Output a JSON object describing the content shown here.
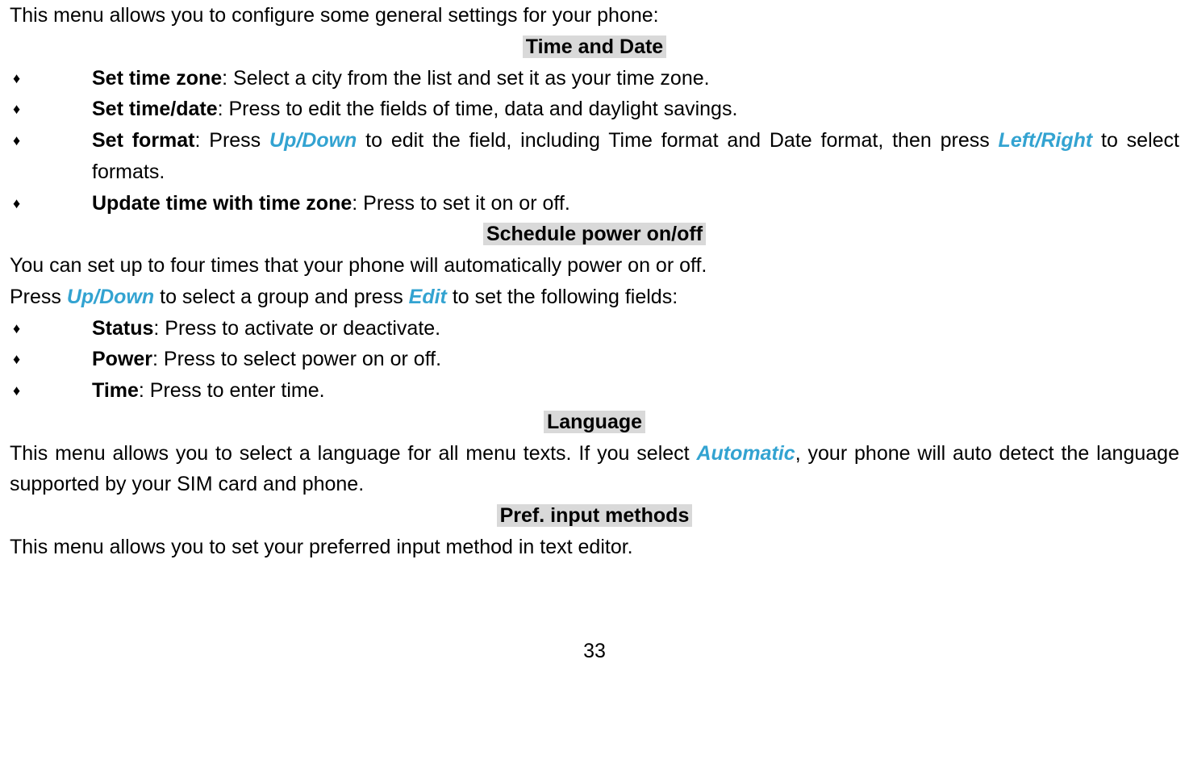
{
  "intro": "This menu allows you to configure some general settings for your phone:",
  "sections": {
    "time_date": {
      "heading": "Time and Date",
      "items": [
        {
          "label": "Set time zone",
          "text_after": ": Select a city from the list and set it as your time zone."
        },
        {
          "label": "Set time/date",
          "text_after": ": Press to edit the fields of time, data and daylight savings."
        },
        {
          "label": "Set format",
          "frag1": ": Press ",
          "key1": "Up/Down",
          "frag2": " to edit the field, including Time format and Date format, then press ",
          "key2": "Left/Right",
          "frag3": " to select formats."
        },
        {
          "label": "Update time with time zone",
          "text_after": ": Press to set it on or off."
        }
      ]
    },
    "schedule": {
      "heading": "Schedule power on/off",
      "para1": "You can set up to four times that your phone will automatically power on or off.",
      "para2_frag1": "Press ",
      "para2_key1": "Up/Down",
      "para2_frag2": " to select a group and press ",
      "para2_key2": "Edit",
      "para2_frag3": " to set the following fields:",
      "items": [
        {
          "label": "Status",
          "text_after": ": Press to activate or deactivate."
        },
        {
          "label": "Power",
          "text_after": ": Press to select power on or off."
        },
        {
          "label": "Time",
          "text_after": ": Press to enter time."
        }
      ]
    },
    "language": {
      "heading": "Language",
      "frag1": "This menu allows you to select a language for all menu texts. If you select ",
      "key1": "Automatic",
      "frag2": ", your phone will auto detect the language supported by your SIM card and phone."
    },
    "pref_input": {
      "heading": "Pref. input methods",
      "para": "This menu allows you to set your preferred input method in text editor."
    }
  },
  "page_number": "33"
}
